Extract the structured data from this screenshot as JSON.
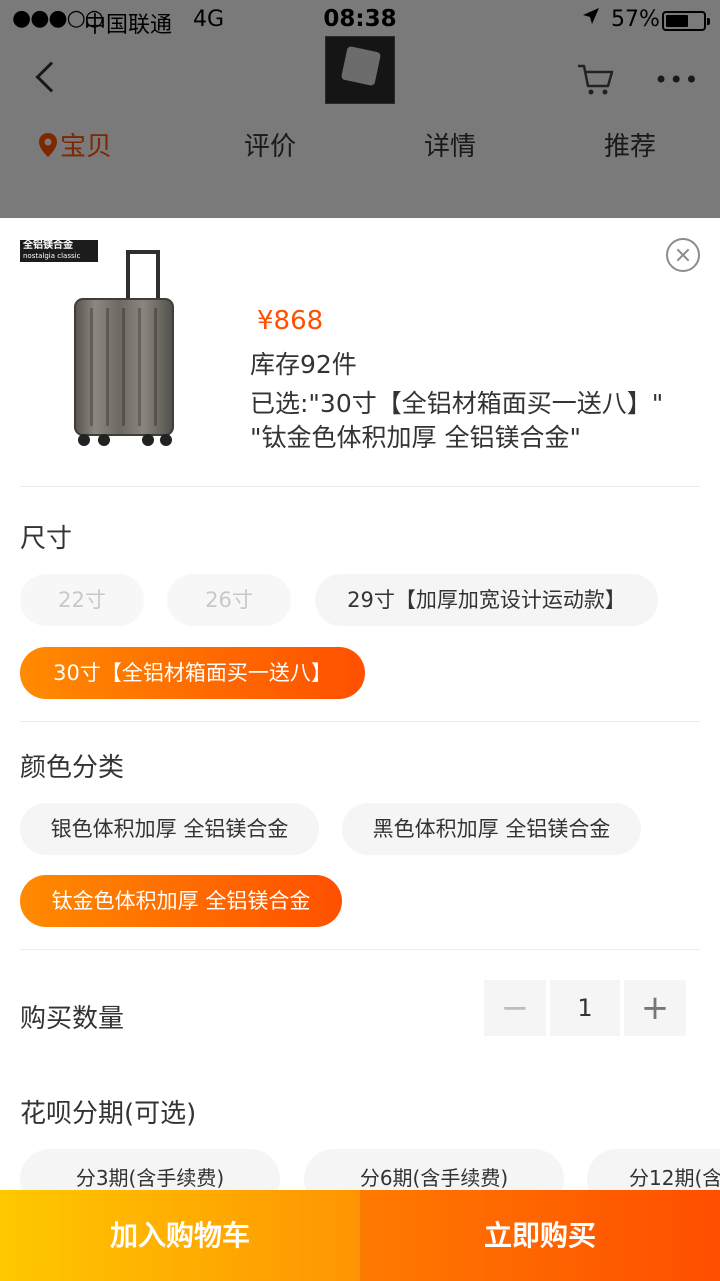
{
  "status_bar": {
    "signal": "●●●○○",
    "carrier": "中国联通",
    "network": "4G",
    "time": "08:38",
    "battery_percent": "57%",
    "battery_level": 0.57
  },
  "nav": {
    "back_icon": "chevron-left-icon",
    "cart_icon": "cart-icon",
    "more_icon": "more-dots-icon",
    "more_glyph": "•••"
  },
  "tabs": [
    {
      "label": "宝贝",
      "active": true
    },
    {
      "label": "评价",
      "active": false
    },
    {
      "label": "详情",
      "active": false
    },
    {
      "label": "推荐",
      "active": false
    }
  ],
  "sku_sheet": {
    "product_badge": {
      "line1": "全铝镁合金",
      "line2": "nostalgia classic"
    },
    "price": "¥868",
    "stock": "库存92件",
    "selected_line1": "已选:\"30寸【全铝材箱面买一送八】\"",
    "selected_line2": "\"钛金色体积加厚 全铝镁合金\"",
    "size": {
      "title": "尺寸",
      "options": [
        {
          "label": "22寸",
          "state": "disabled"
        },
        {
          "label": "26寸",
          "state": "disabled"
        },
        {
          "label": "29寸【加厚加宽设计运动款】",
          "state": "normal"
        },
        {
          "label": "30寸【全铝材箱面买一送八】",
          "state": "selected"
        }
      ]
    },
    "color": {
      "title": "颜色分类",
      "options": [
        {
          "label": "银色体积加厚 全铝镁合金",
          "state": "normal"
        },
        {
          "label": "黑色体积加厚 全铝镁合金",
          "state": "normal"
        },
        {
          "label": "钛金色体积加厚 全铝镁合金",
          "state": "selected"
        }
      ]
    },
    "quantity": {
      "title": "购买数量",
      "value": "1",
      "minus": "−",
      "plus": "+"
    },
    "installment": {
      "title": "花呗分期(可选)",
      "options": [
        {
          "label": "分3期(含手续费)"
        },
        {
          "label": "分6期(含手续费)"
        },
        {
          "label": "分12期(含"
        }
      ]
    }
  },
  "actions": {
    "add_to_cart": "加入购物车",
    "buy_now": "立即购买"
  },
  "colors": {
    "accent": "#ff5000",
    "cart_gradient": [
      "#ffc800",
      "#ff9402"
    ],
    "buy_gradient": [
      "#ff7a00",
      "#ff4e00"
    ]
  }
}
